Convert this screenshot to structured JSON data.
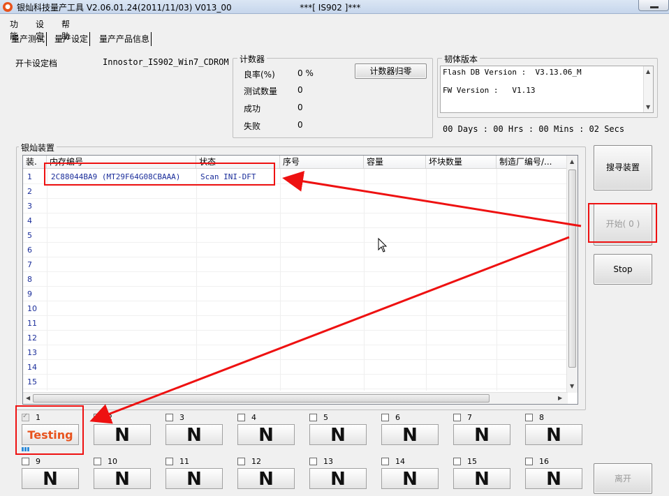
{
  "window": {
    "title": "银灿科技量产工具 V2.06.01.24(2011/11/03)    V013_00",
    "subtitle": "***[ IS902 ]***"
  },
  "menu": [
    "功能",
    "设定",
    "帮助"
  ],
  "tabs": [
    "量产测试",
    "量产设定",
    "量产产品信息"
  ],
  "config": {
    "label": "开卡设定档",
    "value": "Innostor_IS902_Win7_CDROM"
  },
  "counter": {
    "legend": "计数器",
    "rows": [
      {
        "label": "良率(%)",
        "value": "0 %"
      },
      {
        "label": "测试数量",
        "value": "0"
      },
      {
        "label": "成功",
        "value": "0"
      },
      {
        "label": "失败",
        "value": "0"
      }
    ],
    "reset_label": "计数器归零"
  },
  "firmware": {
    "legend": "韧体版本",
    "flash_db_line": "Flash DB Version :  V3.13.06_M",
    "fw_line": "FW Version :   V1.13",
    "elapsed": "00 Days : 00 Hrs : 00 Mins : 02 Secs"
  },
  "devices": {
    "legend": "银灿装置",
    "columns": [
      "装.",
      "内存编号",
      "状态",
      "序号",
      "容量",
      "坏块数量",
      "制造厂编号/..."
    ],
    "rows": [
      {
        "index": "1",
        "memory_id": "2C88044BA9 (MT29F64G08CBAAA)",
        "status": "Scan INI-DFT"
      },
      {
        "index": "2",
        "memory_id": "",
        "status": ""
      },
      {
        "index": "3",
        "memory_id": "",
        "status": ""
      },
      {
        "index": "4",
        "memory_id": "",
        "status": ""
      },
      {
        "index": "5",
        "memory_id": "",
        "status": ""
      },
      {
        "index": "6",
        "memory_id": "",
        "status": ""
      },
      {
        "index": "7",
        "memory_id": "",
        "status": ""
      },
      {
        "index": "8",
        "memory_id": "",
        "status": ""
      },
      {
        "index": "9",
        "memory_id": "",
        "status": ""
      },
      {
        "index": "10",
        "memory_id": "",
        "status": ""
      },
      {
        "index": "11",
        "memory_id": "",
        "status": ""
      },
      {
        "index": "12",
        "memory_id": "",
        "status": ""
      },
      {
        "index": "13",
        "memory_id": "",
        "status": ""
      },
      {
        "index": "14",
        "memory_id": "",
        "status": ""
      },
      {
        "index": "15",
        "memory_id": "",
        "status": ""
      }
    ]
  },
  "buttons": {
    "search": "搜寻装置",
    "start": "开始( 0 )",
    "stop": "Stop",
    "exit": "离开"
  },
  "ports": [
    {
      "num": "1",
      "status": "Testing",
      "checked": true
    },
    {
      "num": "2",
      "status": "N",
      "checked": false
    },
    {
      "num": "3",
      "status": "N",
      "checked": false
    },
    {
      "num": "4",
      "status": "N",
      "checked": false
    },
    {
      "num": "5",
      "status": "N",
      "checked": false
    },
    {
      "num": "6",
      "status": "N",
      "checked": false
    },
    {
      "num": "7",
      "status": "N",
      "checked": false
    },
    {
      "num": "8",
      "status": "N",
      "checked": false
    },
    {
      "num": "9",
      "status": "N",
      "checked": false
    },
    {
      "num": "10",
      "status": "N",
      "checked": false
    },
    {
      "num": "11",
      "status": "N",
      "checked": false
    },
    {
      "num": "12",
      "status": "N",
      "checked": false
    },
    {
      "num": "13",
      "status": "N",
      "checked": false
    },
    {
      "num": "14",
      "status": "N",
      "checked": false
    },
    {
      "num": "15",
      "status": "N",
      "checked": false
    },
    {
      "num": "16",
      "status": "N",
      "checked": false
    }
  ],
  "colors": {
    "highlight": "#ee1111",
    "testing": "#e8531d",
    "table_text": "#1a2d9a"
  }
}
